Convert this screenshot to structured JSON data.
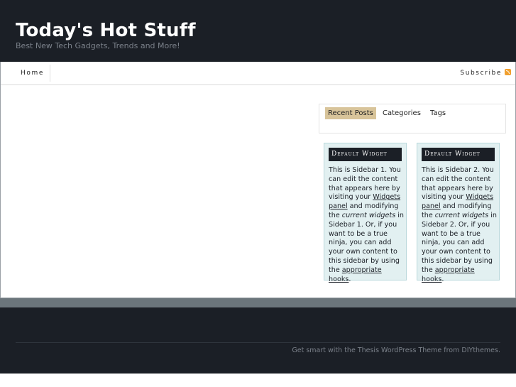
{
  "header": {
    "title": "Today's Hot Stuff",
    "tagline": "Best New Tech Gadgets, Trends and More!"
  },
  "nav": {
    "home_label": "Home",
    "subscribe_label": "Subscribe",
    "subscribe_icon": "rss-icon"
  },
  "tabs": [
    {
      "label": "Recent Posts",
      "active": true
    },
    {
      "label": "Categories",
      "active": false
    },
    {
      "label": "Tags",
      "active": false
    }
  ],
  "widgets": [
    {
      "title": "Default Widget",
      "text_1": "This is Sidebar 1. You can edit the content that appears here by visiting your ",
      "link_1": "Widgets panel",
      "text_2": " and modifying the ",
      "em_1": "current widgets",
      "text_3": " in Sidebar 1. Or, if you want to be a true ninja, you can add your own content to this sidebar by using the ",
      "link_2": "appropriate hooks",
      "text_4": "."
    },
    {
      "title": "Default Widget",
      "text_1": "This is Sidebar 2. You can edit the content that appears here by visiting your ",
      "link_1": "Widgets panel",
      "text_2": " and modifying the ",
      "em_1": "current widgets",
      "text_3": " in Sidebar 2. Or, if you want to be a true ninja, you can add your own content to this sidebar by using the ",
      "link_2": "appropriate hooks",
      "text_4": "."
    }
  ],
  "footer": {
    "text_1": "Get smart with the ",
    "link_1": "Thesis WordPress Theme",
    "text_2": " from ",
    "link_2": "DIYthemes",
    "text_3": "."
  },
  "colors": {
    "background_dark": "#1b1f26",
    "tab_active": "#d8c49a",
    "widget_bg": "#e2f0f1",
    "footer_band": "#6b757b"
  }
}
